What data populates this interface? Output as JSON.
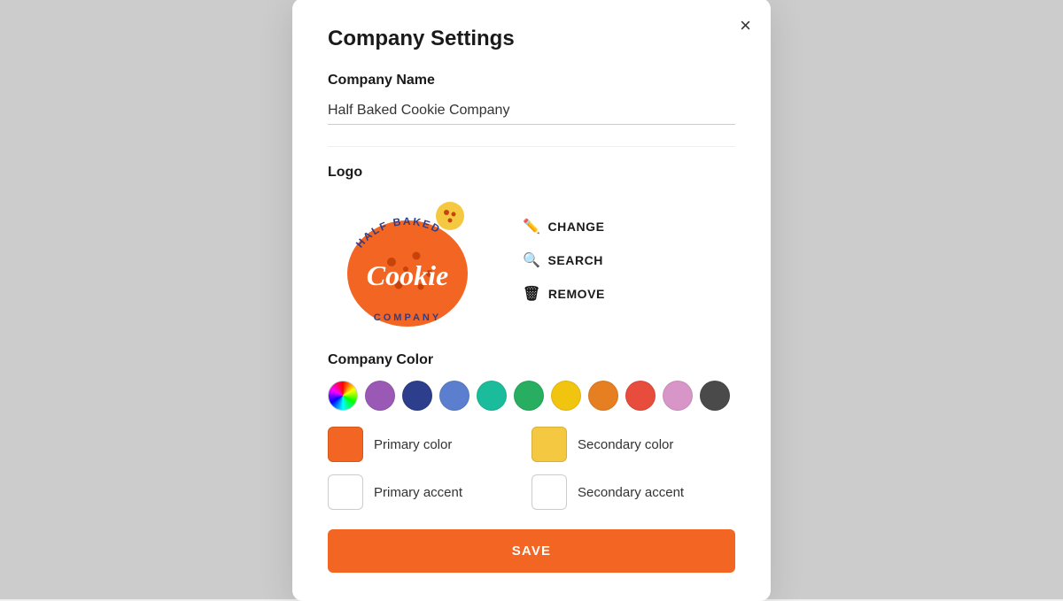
{
  "modal": {
    "title": "Company Settings",
    "close_label": "×"
  },
  "company_name": {
    "label": "Company Name",
    "value": "Half Baked Cookie Company"
  },
  "logo": {
    "label": "Logo",
    "change_label": "CHANGE",
    "search_label": "SEARCH",
    "remove_label": "REMOVE"
  },
  "company_color": {
    "label": "Company Color",
    "swatches": [
      {
        "color": "rainbow",
        "name": "Rainbow picker"
      },
      {
        "color": "#9b59b6",
        "name": "Purple"
      },
      {
        "color": "#2c3e8c",
        "name": "Dark Blue"
      },
      {
        "color": "#5b7fce",
        "name": "Medium Blue"
      },
      {
        "color": "#1abc9c",
        "name": "Teal"
      },
      {
        "color": "#27ae60",
        "name": "Green"
      },
      {
        "color": "#f1c40f",
        "name": "Yellow"
      },
      {
        "color": "#e67e22",
        "name": "Orange"
      },
      {
        "color": "#e74c3c",
        "name": "Red"
      },
      {
        "color": "#d896c8",
        "name": "Pink"
      },
      {
        "color": "#4a4a4a",
        "name": "Dark Gray"
      }
    ],
    "primary_color_label": "Primary color",
    "primary_color_value": "#f26522",
    "secondary_color_label": "Secondary color",
    "secondary_color_value": "#f5c842",
    "primary_accent_label": "Primary accent",
    "primary_accent_value": "#ffffff",
    "secondary_accent_label": "Secondary accent",
    "secondary_accent_value": "#ffffff"
  },
  "save_button": {
    "label": "SAVE"
  }
}
